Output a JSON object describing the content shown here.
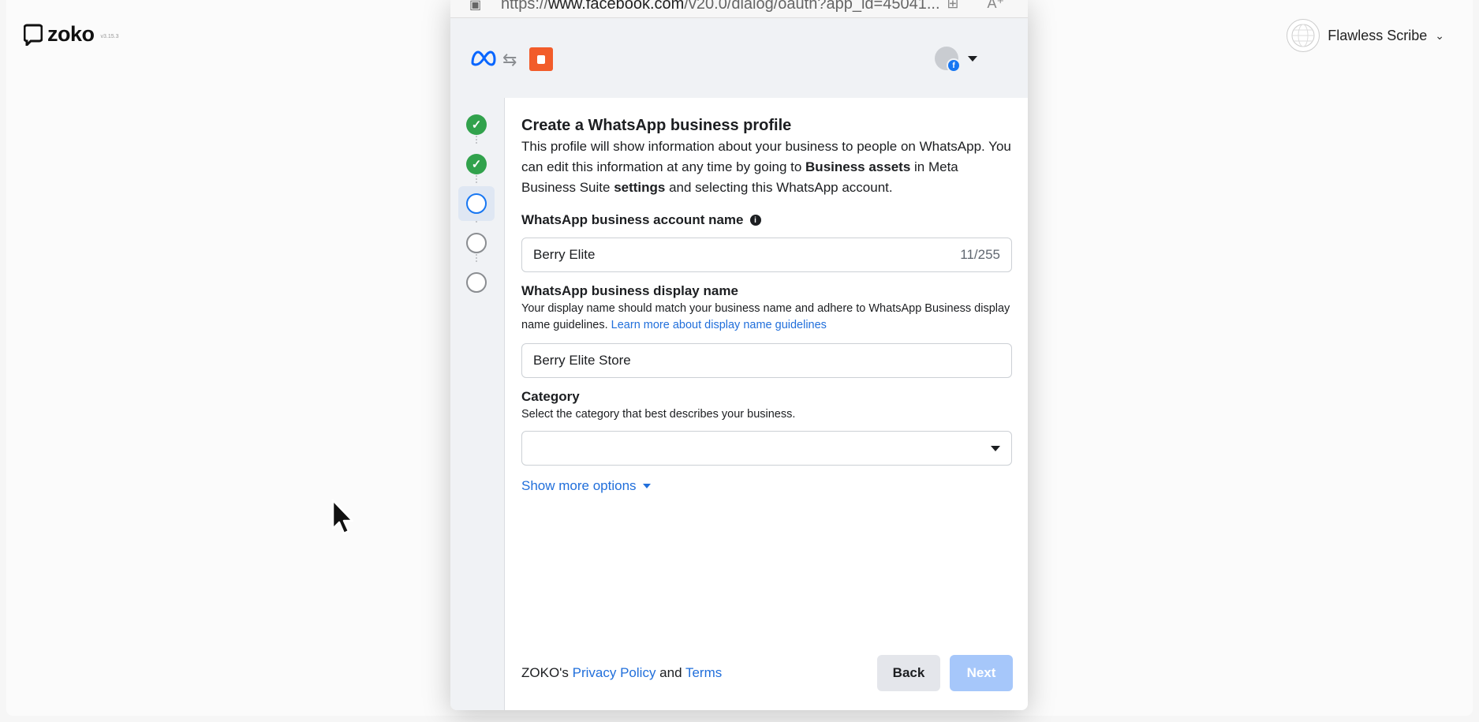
{
  "app": {
    "logo_text": "zoko",
    "version": "v3.15.3",
    "user_name": "Flawless Scribe"
  },
  "browser": {
    "url_prefix": "https://",
    "url_host": "www.facebook.com",
    "url_rest": "/v20.0/dialog/oauth?app_id=45041..."
  },
  "dialog": {
    "steps": [
      "completed",
      "completed",
      "active",
      "todo",
      "todo"
    ],
    "title": "Create a WhatsApp business profile",
    "desc_part1": "This profile will show information about your business to people on WhatsApp. You can edit this information at any time by going to ",
    "desc_bold1": "Business assets",
    "desc_part2": " in Meta Business Suite ",
    "desc_bold2": "settings",
    "desc_part3": " and selecting this WhatsApp account.",
    "account_name_label": "WhatsApp business account name",
    "account_name_value": "Berry Elite",
    "account_name_counter": "11/255",
    "display_name_label": "WhatsApp business display name",
    "display_name_help": "Your display name should match your business name and adhere to WhatsApp Business display name guidelines. ",
    "display_name_link": "Learn more about display name guidelines",
    "display_name_value": "Berry Elite Store",
    "category_label": "Category",
    "category_help": "Select the category that best describes your business.",
    "category_value": "",
    "show_more": "Show more options",
    "footer_prefix": "ZOKO's ",
    "privacy_link": "Privacy Policy",
    "footer_and": " and ",
    "terms_link": "Terms",
    "back_label": "Back",
    "next_label": "Next"
  },
  "colors": {
    "fb_blue": "#1877f2",
    "link_blue": "#216fdb",
    "done_green": "#31a24c",
    "next_disabled": "#a6c7fa",
    "app_icon_orange": "#f25c2a"
  }
}
